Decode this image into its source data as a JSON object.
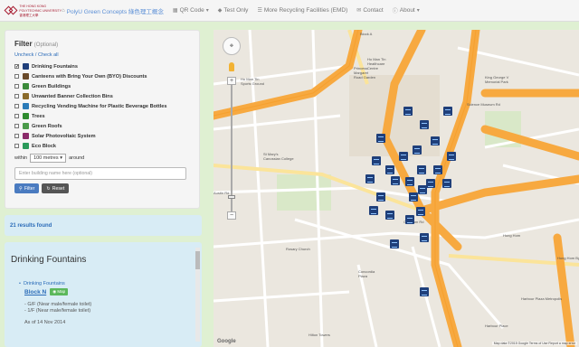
{
  "navbar": {
    "logo_text": [
      "THE HONG KONG",
      "POLYTECHNIC UNIVERSITY",
      "香港理工大學"
    ],
    "items": [
      {
        "label": "PolyU Green Concepts 綠色理工概念",
        "icon": "home-icon"
      },
      {
        "label": "QR Code",
        "icon": "qr-icon",
        "caret": true
      },
      {
        "label": "Test Only",
        "icon": "tag-icon"
      },
      {
        "label": "More Recycling Facilities (EMD)",
        "icon": "list-icon"
      },
      {
        "label": "Contact",
        "icon": "envelope-icon"
      },
      {
        "label": "About",
        "icon": "info-icon",
        "caret": true
      }
    ]
  },
  "filter": {
    "title": "Filter",
    "optional": "(Optional)",
    "links": "Uncheck / Check all",
    "layers": [
      {
        "label": "Drinking Fountains",
        "checked": true,
        "color": "#1f3f7a"
      },
      {
        "label": "Canteens with Bring Your Own (BYO) Discounts",
        "checked": false,
        "color": "#6a4a2a"
      },
      {
        "label": "Green Buildings",
        "checked": false,
        "color": "#3a8a3a"
      },
      {
        "label": "Unwanted Banner Collection Bins",
        "checked": false,
        "color": "#8a6a2a"
      },
      {
        "label": "Recycling Vending Machine for Plastic Beverage Bottles",
        "checked": false,
        "color": "#2a7ab8"
      },
      {
        "label": "Trees",
        "checked": false,
        "color": "#2e8b2e"
      },
      {
        "label": "Green Roofs",
        "checked": false,
        "color": "#4a9a4a"
      },
      {
        "label": "Solar Photovoltaic System",
        "checked": false,
        "color": "#8a2a6a"
      },
      {
        "label": "Eco Block",
        "checked": false,
        "color": "#2a9a5a"
      }
    ],
    "within_label": "within",
    "within_value": "100 metres",
    "around_label": "around",
    "building_placeholder": "Enter building name here (optional)",
    "filter_button": "Filter",
    "reset_button": "Reset"
  },
  "results": {
    "count_text": "21 results found"
  },
  "detail": {
    "title": "Drinking Fountains",
    "item_label": "Drinking Fountains",
    "block": "Block N",
    "map_button": "Map",
    "lines": [
      "- G/F (Near male/female toilet)",
      "- 1/F (Near male/female toilet)"
    ],
    "as_of": "As of 14 Nov 2014"
  },
  "map": {
    "labels": [
      {
        "text": "Block A",
        "pos": "a"
      },
      {
        "text": "Princess\nMargaret\nRoad Garden",
        "pos": "b"
      },
      {
        "text": "Ho Man Tin\nHealthcare\nCentre",
        "pos": "c"
      },
      {
        "text": "Ho Man Tin\nSports Ground",
        "pos": "d"
      },
      {
        "text": "St Mary's\nCanossian College",
        "pos": "e"
      },
      {
        "text": "King George V\nMemorial Park",
        "pos": "f"
      },
      {
        "text": "Harbour Plaza Metropolis",
        "pos": "g"
      },
      {
        "text": "Hung Hom",
        "pos": "h"
      },
      {
        "text": "Rosary Church",
        "pos": "i"
      },
      {
        "text": "Concordia\nPlaza",
        "pos": "j"
      },
      {
        "text": "Harbour Place",
        "pos": "k"
      },
      {
        "text": "Hilton Towers",
        "pos": "l"
      },
      {
        "text": "Austin Rd",
        "pos": "m"
      },
      {
        "text": "Chatham Rd",
        "pos": "n"
      },
      {
        "text": "Science Museum Rd",
        "pos": "o"
      },
      {
        "text": "Hung Hom Bypass",
        "pos": "p"
      }
    ],
    "footer": "Map data ©2015 Google   Terms of Use   Report a map error",
    "google": "Google"
  }
}
